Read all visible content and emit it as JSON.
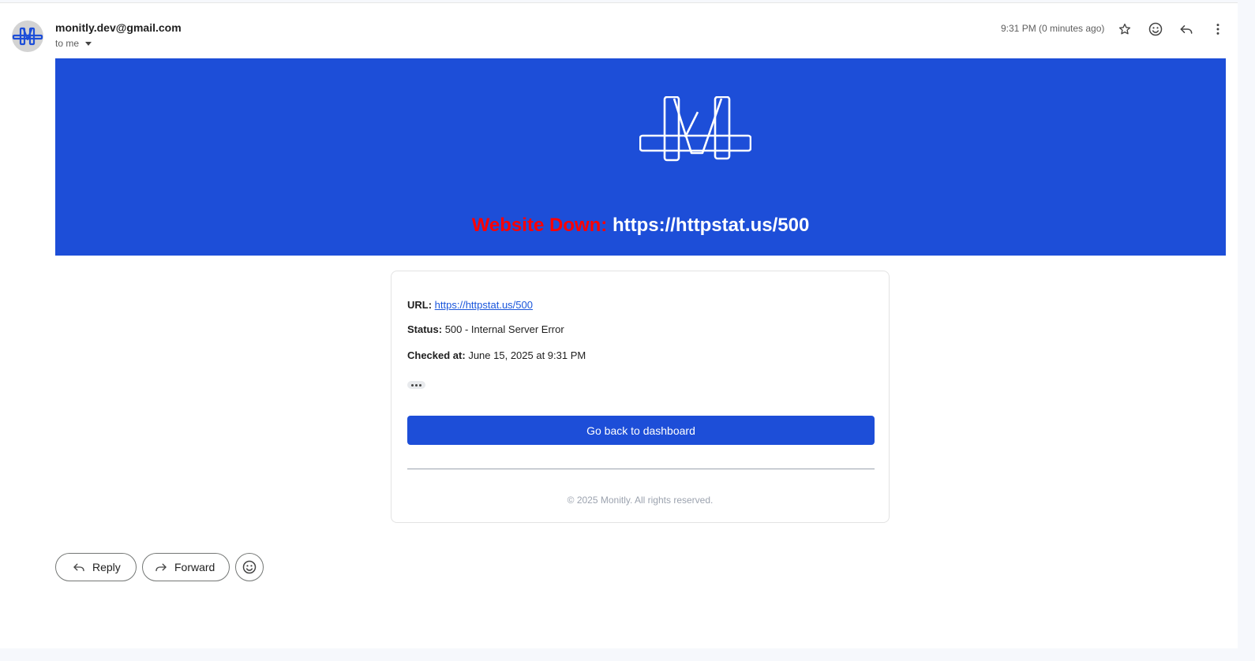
{
  "header": {
    "sender": "monitly.dev@gmail.com",
    "recipient": "to me",
    "time": "9:31 PM (0 minutes ago)",
    "icons": [
      "star-icon",
      "emoji-icon",
      "reply-icon",
      "more-vert-icon"
    ]
  },
  "banner": {
    "background": "#1d4ed8",
    "title_alert": "Website Down:",
    "title_url": "https://httpstat.us/500",
    "alert_color": "#ff0000"
  },
  "details": {
    "url_label": "URL:",
    "url_value": "https://httpstat.us/500",
    "status_label": "Status:",
    "status_value": "500 - Internal Server Error",
    "checked_label": "Checked at:",
    "checked_value": "June 15, 2025 at 9:31 PM",
    "button_label": "Go back to dashboard",
    "footer": "© 2025 Monitly. All rights reserved."
  },
  "actions": {
    "reply_label": "Reply",
    "forward_label": "Forward"
  }
}
